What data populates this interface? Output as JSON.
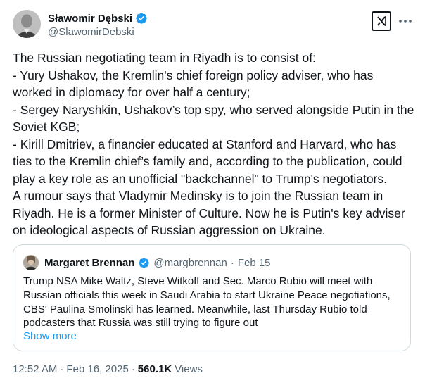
{
  "author": {
    "display_name": "Sławomir Dębski",
    "handle": "@SlawomirDebski"
  },
  "tweet_text": "The Russian negotiating team in Riyadh is to consist of:\n- Yury Ushakov, the Kremlin's chief foreign policy adviser, who has worked in diplomacy for over half a century;\n- Sergey Naryshkin, Ushakov’s top spy, who served alongside Putin in the Soviet KGB;\n- Kirill Dmitriev, a financier educated at Stanford and Harvard, who has ties to the Kremlin chief’s family and, according to the publication, could play a key role as an unofficial \"backchannel\" to Trump's negotiators.\nA rumour says that Vladymir Medinsky is to join the Russian team in Riyadh. He is a former Minister of Culture. Now he is Putin's key adviser on ideological aspects of Russian aggression on Ukraine.",
  "quoted": {
    "display_name": "Margaret Brennan",
    "handle": "@margbrennan",
    "separator": "·",
    "date": "Feb 15",
    "text": "Trump NSA Mike Waltz, Steve Witkoff and Sec. Marco Rubio will meet with Russian officials this week in Saudi Arabia to start Ukraine Peace negotiations, CBS' Paulina Smolinski has learned. Meanwhile, last Thursday Rubio told podcasters that Russia was still trying to figure out",
    "show_more": "Show more"
  },
  "footer": {
    "time": "12:52 AM",
    "sep1": "·",
    "date": "Feb 16, 2025",
    "sep2": "·",
    "views_count": "560.1K",
    "views_label": "Views"
  },
  "icons": {
    "verified": "verified-badge-icon",
    "grok": "grok-icon",
    "more": "more-icon"
  },
  "colors": {
    "verified_blue": "#1d9bf0",
    "secondary_text": "#536471",
    "link": "#1d9bf0",
    "border": "#cfd9de"
  }
}
